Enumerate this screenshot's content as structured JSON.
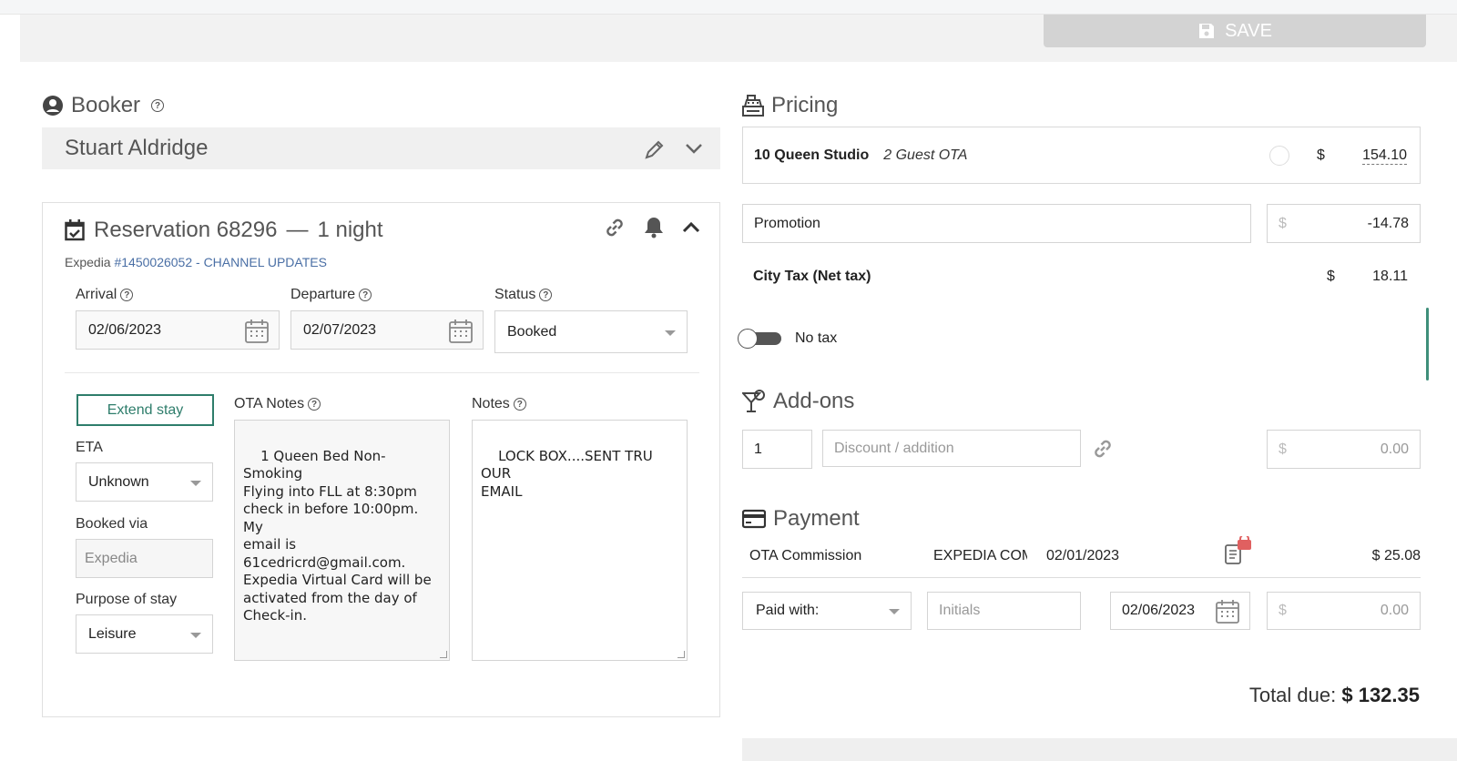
{
  "toolbar": {
    "save_label": "SAVE"
  },
  "booker": {
    "title": "Booker",
    "name": "Stuart Aldridge"
  },
  "reservation": {
    "title": "Reservation 68296",
    "nights": "1 night",
    "channel_prefix": "Expedia ",
    "channel_ref": "#1450026052 - CHANNEL UPDATES",
    "arrival_label": "Arrival",
    "arrival_value": "02/06/2023",
    "departure_label": "Departure",
    "departure_value": "02/07/2023",
    "status_label": "Status",
    "status_value": "Booked",
    "extend_label": "Extend stay",
    "eta_label": "ETA",
    "eta_value": "Unknown",
    "booked_via_label": "Booked via",
    "booked_via_value": "Expedia",
    "purpose_label": "Purpose of stay",
    "purpose_value": "Leisure",
    "ota_notes_label": "OTA Notes",
    "ota_notes_value": "1 Queen Bed Non-Smoking\nFlying into FLL at 8:30pm\ncheck in before 10:00pm. My\nemail is\n61cedricrd@gmail.com.\nExpedia Virtual Card will be\nactivated from the day of\nCheck-in.",
    "notes_label": "Notes",
    "notes_value": "LOCK BOX....SENT TRU OUR\nEMAIL"
  },
  "pricing": {
    "title": "Pricing",
    "room": "10 Queen Studio",
    "rate": "2 Guest OTA",
    "currency": "$",
    "room_amount": "154.10",
    "promotion_label": "Promotion",
    "promotion_amount": "-14.78",
    "tax_label": "City Tax (Net tax)",
    "tax_amount": "18.11",
    "no_tax_label": "No tax"
  },
  "addons": {
    "title": "Add-ons",
    "quantity": "1",
    "discount_placeholder": "Discount / addition",
    "amount": "0.00"
  },
  "payment": {
    "title": "Payment",
    "row": {
      "type": "OTA Commission",
      "method": "EXPEDIA COM",
      "date": "02/01/2023",
      "amount": "$ 25.08"
    },
    "paid_with_label": "Paid with:",
    "initials_placeholder": "Initials",
    "date_value": "02/06/2023",
    "amount": "0.00"
  },
  "total": {
    "label": "Total due:",
    "value": "$ 132.35"
  },
  "colors": {
    "accent": "#2e7d6b",
    "link": "#4a6fa5",
    "lock": "#e06060"
  }
}
